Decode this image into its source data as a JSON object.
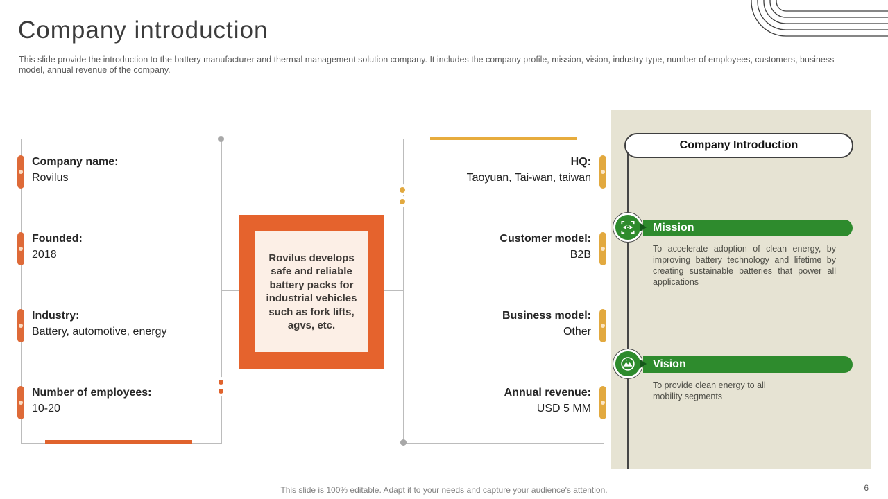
{
  "slide": {
    "title": "Company introduction",
    "subtitle": "This slide provide the introduction to the battery manufacturer and thermal management solution company. It includes the company profile, mission, vision, industry type,  number of employees, customers, business model, annual revenue of the company.",
    "footer": "This slide is 100% editable. Adapt it to your needs and capture your audience's attention.",
    "page_number": "6"
  },
  "facts_left": [
    {
      "label": "Company name:",
      "value": "Rovilus"
    },
    {
      "label": "Founded:",
      "value": "2018"
    },
    {
      "label": "Industry:",
      "value": "Battery, automotive, energy"
    },
    {
      "label": "Number of employees:",
      "value": "10-20"
    }
  ],
  "facts_right": [
    {
      "label": "HQ:",
      "value": "Taoyuan, Tai-wan, taiwan"
    },
    {
      "label": "Customer model:",
      "value": "B2B"
    },
    {
      "label": "Business model:",
      "value": "Other"
    },
    {
      "label": "Annual revenue:",
      "value": "USD 5 MM"
    }
  ],
  "center_box": {
    "text": "Rovilus develops safe and reliable battery packs for industrial vehicles such as fork lifts, agvs, etc."
  },
  "sidebar": {
    "header": "Company Introduction",
    "sections": [
      {
        "title": "Mission",
        "icon": "eye-focus-icon",
        "text": "To accelerate adoption of clean energy, by improving battery technology and lifetime by creating sustainable batteries that power all applications"
      },
      {
        "title": "Vision",
        "icon": "mountain-flag-icon",
        "text": "To provide clean energy to all mobility segments"
      }
    ]
  },
  "colors": {
    "orange": "#E0632D",
    "gold": "#E2A93F",
    "green": "#2E8B2D",
    "beige": "#E6E3D3",
    "callout_fill": "#FCEFE6"
  }
}
